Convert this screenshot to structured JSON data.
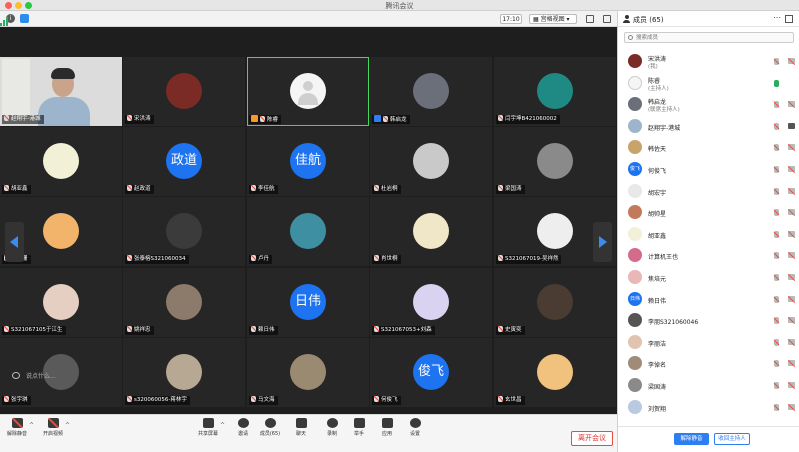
{
  "app": {
    "title": "腾讯会议"
  },
  "topbar": {
    "time": "17:10",
    "view_label": "宫格视图"
  },
  "colors": {
    "accent": "#2d7ef0",
    "leave": "#e02e2e",
    "active_border": "#41d95e",
    "text_avatar": "#1d73f0"
  },
  "tiles": [
    {
      "name": "赵翔宇-港城",
      "kind": "video"
    },
    {
      "name": "宋洪涛",
      "kind": "photo",
      "color": "#7a2b25"
    },
    {
      "name": "陈睿",
      "kind": "default",
      "host": true,
      "active": true
    },
    {
      "name": "韩启龙",
      "kind": "photo",
      "color": "#6b6f7a",
      "cohost": true
    },
    {
      "name": "闫宇坤B421060002",
      "kind": "photo",
      "color": "#1f8a83"
    },
    {
      "name": "胡亚鑫",
      "kind": "photo",
      "color": "#f3f0d8"
    },
    {
      "name": "赵政道",
      "kind": "text",
      "text": "政道"
    },
    {
      "name": "李佳航",
      "kind": "text",
      "text": "佳航"
    },
    {
      "name": "杜岩桐",
      "kind": "photo",
      "color": "#c9c9c9"
    },
    {
      "name": "梁国涛",
      "kind": "photo",
      "color": "#8a8a8a"
    },
    {
      "name": "隋珊珊",
      "kind": "photo",
      "color": "#f2b36b"
    },
    {
      "name": "张泰榕S321060034",
      "kind": "photo",
      "color": "#3b3b3b"
    },
    {
      "name": "卢丹",
      "kind": "photo",
      "color": "#3f8fa3"
    },
    {
      "name": "肖世桐",
      "kind": "photo",
      "color": "#f0e6c8"
    },
    {
      "name": "S321067019-吴祥然",
      "kind": "photo",
      "color": "#eeeeee"
    },
    {
      "name": "S321067105于江生",
      "kind": "photo",
      "color": "#e4cfc2"
    },
    {
      "name": "姚祥忠",
      "kind": "photo",
      "color": "#8c7b6a"
    },
    {
      "name": "赖日伟",
      "kind": "text",
      "text": "日伟"
    },
    {
      "name": "S321067053+刘森",
      "kind": "photo",
      "color": "#d9d2f0"
    },
    {
      "name": "史寅奕",
      "kind": "photo",
      "color": "#4a3b33"
    },
    {
      "name": "张宇琪",
      "kind": "photo",
      "color": "#5a5a5a"
    },
    {
      "name": "s320060056-蒋林宇",
      "kind": "photo",
      "color": "#b7a893"
    },
    {
      "name": "马文海",
      "kind": "photo",
      "color": "#9b8a72"
    },
    {
      "name": "何俊飞",
      "kind": "text",
      "text": "俊飞"
    },
    {
      "name": "玄世昌",
      "kind": "photo",
      "color": "#f1c27d"
    }
  ],
  "chat_hint": "说点什么...",
  "toolbar": {
    "unmute": "解除静音",
    "start_video": "开启视频",
    "share": "共享屏幕",
    "invite": "邀请",
    "members": "成员(65)",
    "chat": "聊天",
    "record": "录制",
    "raise_hand": "举手",
    "apps": "应用",
    "settings": "设置",
    "leave": "离开会议"
  },
  "panel": {
    "title": "成员 (65)",
    "search_placeholder": "搜索成员",
    "mute_all": "解除静音",
    "reclaim_host": "收回主持人",
    "members": [
      {
        "name": "宋洪涛",
        "role": "(我)",
        "avatar_color": "#7a2b25",
        "mic": "muted",
        "video": "off"
      },
      {
        "name": "陈睿",
        "role": "(主持人)",
        "avatar_color": "#f5f5f5",
        "mic": "on",
        "video": "none"
      },
      {
        "name": "韩启龙",
        "role": "(联席主持人)",
        "avatar_color": "#6b6f7a",
        "mic": "muted",
        "video": "off"
      },
      {
        "name": "赵翔宇-港城",
        "role": "",
        "avatar_color": "#9cb4cc",
        "mic": "muted",
        "video": "on"
      },
      {
        "name": "韩佐天",
        "role": "",
        "avatar_color": "#c8a36a",
        "mic": "muted",
        "video": "off"
      },
      {
        "name": "何俊飞",
        "role": "",
        "avatar_text": "俊飞",
        "mic": "muted",
        "video": "off"
      },
      {
        "name": "胡宏宇",
        "role": "",
        "avatar_color": "#e8e8e8",
        "mic": "muted",
        "video": "off"
      },
      {
        "name": "胡帅星",
        "role": "",
        "avatar_color": "#c47a5a",
        "mic": "muted",
        "video": "off"
      },
      {
        "name": "胡亚鑫",
        "role": "",
        "avatar_color": "#f3f0d8",
        "mic": "muted",
        "video": "off"
      },
      {
        "name": "计算机王也",
        "role": "",
        "avatar_color": "#d46a8c",
        "mic": "muted",
        "video": "off"
      },
      {
        "name": "焦培元",
        "role": "",
        "avatar_color": "#e9b7b7",
        "mic": "muted",
        "video": "off"
      },
      {
        "name": "赖日伟",
        "role": "",
        "avatar_text": "日伟",
        "mic": "muted",
        "video": "off"
      },
      {
        "name": "李朋S321060046",
        "role": "",
        "avatar_color": "#555555",
        "mic": "muted",
        "video": "off"
      },
      {
        "name": "李丽洁",
        "role": "",
        "avatar_color": "#e2c3b0",
        "mic": "muted",
        "video": "off"
      },
      {
        "name": "李倬名",
        "role": "",
        "avatar_color": "#a08a78",
        "mic": "muted",
        "video": "off"
      },
      {
        "name": "梁国涛",
        "role": "",
        "avatar_color": "#8a8a8a",
        "mic": "muted",
        "video": "off"
      },
      {
        "name": "刘贺翔",
        "role": "",
        "avatar_color": "#b8c9e0",
        "mic": "muted",
        "video": "off"
      }
    ]
  }
}
